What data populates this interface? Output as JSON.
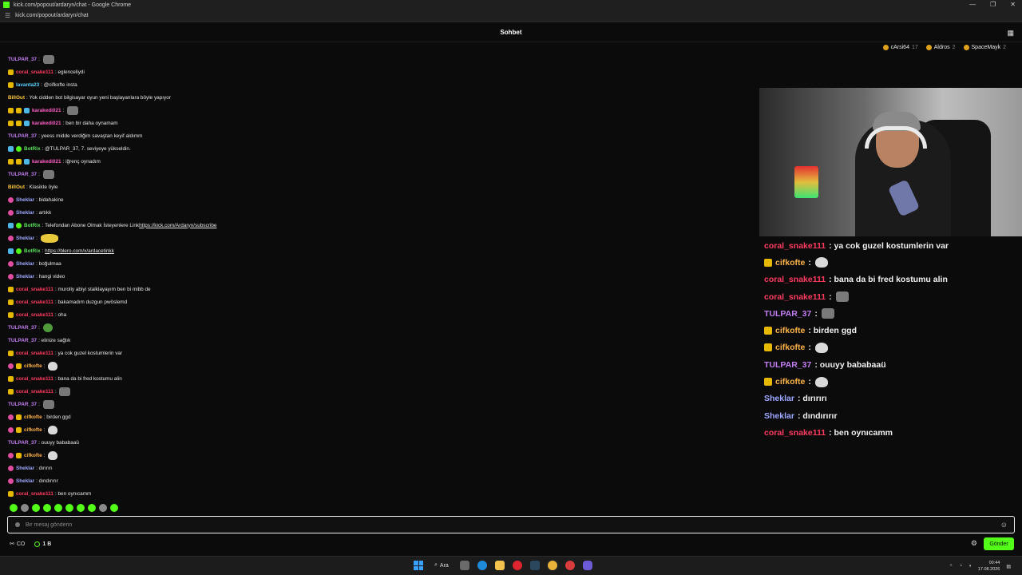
{
  "window": {
    "title": "kick.com/popout/ardaryn/chat - Google Chrome",
    "url": "kick.com/popout/ardaryn/chat",
    "controls": [
      "—",
      "❐",
      "✕"
    ]
  },
  "header": {
    "title": "Sohbet"
  },
  "pinned": [
    {
      "name": "cArsi64",
      "count": "17",
      "coin": "gold"
    },
    {
      "name": "Aldros",
      "count": "2",
      "coin": "gold"
    },
    {
      "name": "SpaceMayk",
      "count": "2",
      "coin": "gold"
    }
  ],
  "colors": {
    "accent": "#53fc18",
    "sub_badge": "#e6b800",
    "vip_badge": "#e14ba0",
    "mod_badge": "#4fb7e8",
    "tulpar": "#c27ef2",
    "coral": "#ff3b5f",
    "sheklar": "#9da7ff",
    "botrix": "#59e05b",
    "karakedi": "#ff5ec4",
    "billout": "#ffc93b",
    "lavanta": "#5ad0ff",
    "cifkofte": "#ffb347"
  },
  "messages": [
    {
      "badges": [],
      "user": "TULPAR_37",
      "color": "#c27ef2",
      "text": "",
      "emote": "dark"
    },
    {
      "badges": [
        "sub"
      ],
      "user": "coral_snake111",
      "color": "#ff3b5f",
      "text": "eglenceliydi",
      "emote": ""
    },
    {
      "badges": [
        "sub"
      ],
      "user": "lavanta23",
      "color": "#5ad0ff",
      "text": "@cifkofte insta",
      "emote": ""
    },
    {
      "badges": [],
      "user": "BillOut",
      "color": "#ffc93b",
      "text": "Yok cidden bot bilgisayar oyun yeni başlayanlara böyle yapıyor",
      "emote": ""
    },
    {
      "badges": [
        "sub",
        "sub",
        "mod"
      ],
      "user": "karakedi021",
      "color": "#ff5ec4",
      "text": "",
      "emote": "dark"
    },
    {
      "badges": [
        "sub",
        "sub",
        "mod"
      ],
      "user": "karakedi021",
      "color": "#ff5ec4",
      "text": "ben bir daha oynamam",
      "emote": ""
    },
    {
      "badges": [],
      "user": "TULPAR_37",
      "color": "#c27ef2",
      "text": "yeess midde verdiğim savaştan keyif aldımm",
      "emote": ""
    },
    {
      "badges": [
        "mod",
        "ver"
      ],
      "user": "BotRix",
      "color": "#59e05b",
      "text": "@TULPAR_37, 7. seviyeye yükseldin.",
      "emote": ""
    },
    {
      "badges": [
        "sub",
        "sub",
        "mod"
      ],
      "user": "karakedi021",
      "color": "#ff5ec4",
      "text": "iğrenç oynadım",
      "emote": ""
    },
    {
      "badges": [],
      "user": "TULPAR_37",
      "color": "#c27ef2",
      "text": "",
      "emote": "dark"
    },
    {
      "badges": [],
      "user": "BillOut",
      "color": "#ffc93b",
      "text": "Klasikte öyle",
      "emote": ""
    },
    {
      "badges": [
        "vip"
      ],
      "user": "Sheklar",
      "color": "#9da7ff",
      "text": "bidahakine",
      "emote": ""
    },
    {
      "badges": [
        "vip"
      ],
      "user": "Sheklar",
      "color": "#9da7ff",
      "text": "artıkk",
      "emote": ""
    },
    {
      "badges": [
        "mod",
        "ver"
      ],
      "user": "BotRix",
      "color": "#59e05b",
      "text": "Telefondan Abone Olmak İsteyenlere Link ",
      "link": "https://kick.com/Ardaryn/subscribe",
      "emote": ""
    },
    {
      "badges": [
        "vip"
      ],
      "user": "Sheklar",
      "color": "#9da7ff",
      "text": "",
      "emote": "yellow"
    },
    {
      "badges": [
        "mod",
        "ver"
      ],
      "user": "BotRix",
      "color": "#59e05b",
      "text": "",
      "link": "https://blero.com/x/ardacetinkk",
      "emote": ""
    },
    {
      "badges": [
        "vip"
      ],
      "user": "Sheklar",
      "color": "#9da7ff",
      "text": "boğulmaa",
      "emote": ""
    },
    {
      "badges": [
        "vip"
      ],
      "user": "Sheklar",
      "color": "#9da7ff",
      "text": "hangi video",
      "emote": ""
    },
    {
      "badges": [
        "sub"
      ],
      "user": "coral_snake111",
      "color": "#ff3b5f",
      "text": "murolly abiyi stalklayayım ben bi mibb de",
      "emote": ""
    },
    {
      "badges": [
        "sub"
      ],
      "user": "coral_snake111",
      "color": "#ff3b5f",
      "text": "bakamadım duzgun pwöslemd",
      "emote": ""
    },
    {
      "badges": [
        "sub"
      ],
      "user": "coral_snake111",
      "color": "#ff3b5f",
      "text": "oha",
      "emote": ""
    },
    {
      "badges": [],
      "user": "TULPAR_37",
      "color": "#c27ef2",
      "text": "",
      "emote": "green"
    },
    {
      "badges": [],
      "user": "TULPAR_37",
      "color": "#c27ef2",
      "text": "elinize sağlık",
      "emote": ""
    },
    {
      "badges": [
        "sub"
      ],
      "user": "coral_snake111",
      "color": "#ff3b5f",
      "text": "ya cok guzel kostumlerin var",
      "emote": ""
    },
    {
      "badges": [
        "vip",
        "sub"
      ],
      "user": "cifkofte",
      "color": "#ffb347",
      "text": "",
      "emote": "round"
    },
    {
      "badges": [
        "sub"
      ],
      "user": "coral_snake111",
      "color": "#ff3b5f",
      "text": "bana da bi fred kostumu alin",
      "emote": ""
    },
    {
      "badges": [
        "sub"
      ],
      "user": "coral_snake111",
      "color": "#ff3b5f",
      "text": "",
      "emote": "dark"
    },
    {
      "badges": [],
      "user": "TULPAR_37",
      "color": "#c27ef2",
      "text": "",
      "emote": "dark"
    },
    {
      "badges": [
        "vip",
        "sub"
      ],
      "user": "cifkofte",
      "color": "#ffb347",
      "text": "birden ggd",
      "emote": ""
    },
    {
      "badges": [
        "vip",
        "sub"
      ],
      "user": "cifkofte",
      "color": "#ffb347",
      "text": "",
      "emote": "round"
    },
    {
      "badges": [],
      "user": "TULPAR_37",
      "color": "#c27ef2",
      "text": "ouuyy bababaaü",
      "emote": ""
    },
    {
      "badges": [
        "vip",
        "sub"
      ],
      "user": "cifkofte",
      "color": "#ffb347",
      "text": "",
      "emote": "round"
    },
    {
      "badges": [
        "vip"
      ],
      "user": "Sheklar",
      "color": "#9da7ff",
      "text": "dırırırı",
      "emote": ""
    },
    {
      "badges": [
        "vip"
      ],
      "user": "Sheklar",
      "color": "#9da7ff",
      "text": "dındırırır",
      "emote": ""
    },
    {
      "badges": [
        "sub"
      ],
      "user": "coral_snake111",
      "color": "#ff3b5f",
      "text": "ben oynıcamm",
      "emote": ""
    }
  ],
  "stream_chat": [
    {
      "user": "coral_snake111",
      "color": "#ff3b5f",
      "badge": false,
      "text": "ya cok guzel kostumlerin var",
      "emote": ""
    },
    {
      "user": "cifkofte",
      "color": "#ffb347",
      "badge": true,
      "text": "",
      "emote": "round"
    },
    {
      "user": "coral_snake111",
      "color": "#ff3b5f",
      "badge": false,
      "text": "bana da bi fred kostumu alin",
      "emote": ""
    },
    {
      "user": "coral_snake111",
      "color": "#ff3b5f",
      "badge": false,
      "text": "",
      "emote": "dark"
    },
    {
      "user": "TULPAR_37",
      "color": "#c27ef2",
      "badge": false,
      "text": "",
      "emote": "dark"
    },
    {
      "user": "cifkofte",
      "color": "#ffb347",
      "badge": true,
      "text": "birden ggd",
      "emote": ""
    },
    {
      "user": "cifkofte",
      "color": "#ffb347",
      "badge": true,
      "text": "",
      "emote": "round"
    },
    {
      "user": "TULPAR_37",
      "color": "#c27ef2",
      "badge": false,
      "text": "ouuyy bababaaü",
      "emote": ""
    },
    {
      "user": "cifkofte",
      "color": "#ffb347",
      "badge": true,
      "text": "",
      "emote": "round"
    },
    {
      "user": "Sheklar",
      "color": "#9da7ff",
      "badge": false,
      "text": "dırırırı",
      "emote": ""
    },
    {
      "user": "Sheklar",
      "color": "#9da7ff",
      "badge": false,
      "text": "dındırırır",
      "emote": ""
    },
    {
      "user": "coral_snake111",
      "color": "#ff3b5f",
      "badge": false,
      "text": "ben oynıcamm",
      "emote": ""
    }
  ],
  "emote_bar_count": 10,
  "input": {
    "placeholder": "Bir mesaj gönderin",
    "value": ""
  },
  "footer": {
    "points_a": "CO",
    "points_b": "1 B",
    "send_label": "Gönder"
  },
  "taskbar": {
    "search_label": "Ara",
    "time": "00:44",
    "date": "17.08.2026"
  }
}
